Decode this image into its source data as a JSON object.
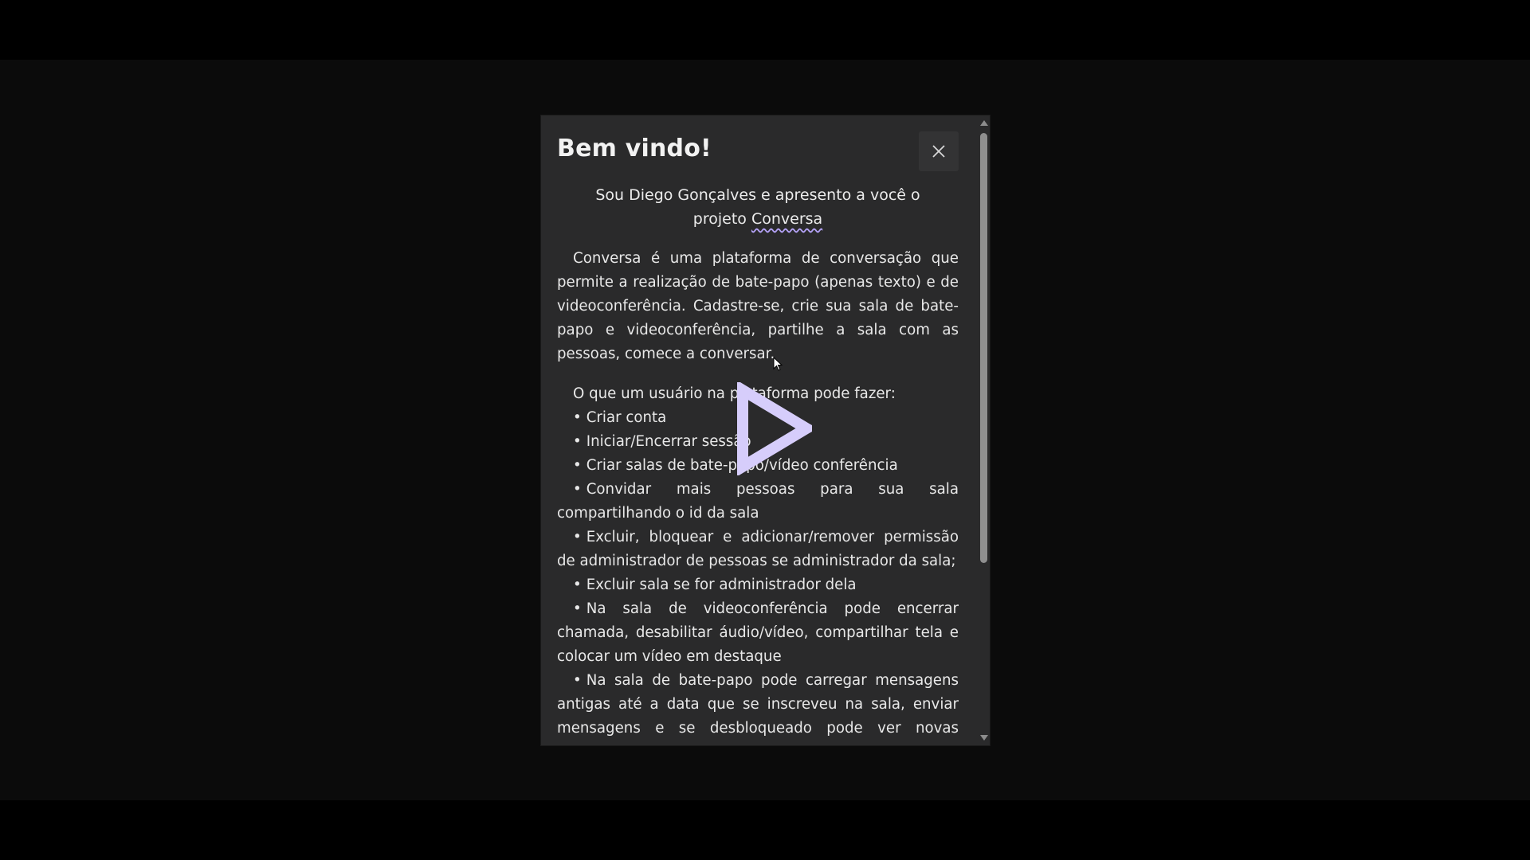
{
  "modal": {
    "title": "Bem vindo!",
    "close_icon": "close-icon",
    "intro_line1": "Sou Diego Gonçalves e apresento a você o",
    "intro_prefix": "projeto ",
    "project_name": "Conversa",
    "description": "Conversa é uma plataforma de conversação que permite a realização de bate-papo (apenas texto) e de videoconferência. Cadastre-se, crie sua sala de bate-papo e videoconferência, partilhe a sala com as pessoas, comece a conversar.",
    "features_heading": "O que um usuário na plataforma pode fazer:",
    "features": [
      "Criar conta",
      "Iniciar/Encerrar sessão",
      "Criar salas de bate-papo/vídeo conferência",
      "Convidar mais pessoas para sua sala compartilhando o id da sala",
      "Excluir, bloquear e adicionar/remover permissão de administrador de pessoas se administrador da sala;",
      "Excluir sala se for administrador dela",
      "Na sala de videoconferência pode encerrar chamada, desabilitar áudio/vídeo, compartilhar tela e colocar um vídeo em destaque",
      "Na sala de bate-papo pode carregar mensagens antigas até a data que se inscreveu na sala, enviar mensagens e se desbloqueado pode ver novas mensagens"
    ],
    "bullet": "•"
  },
  "overlay": {
    "play_icon": "play-icon",
    "play_color": "#d6cdfb",
    "cursor_icon": "cursor-icon"
  },
  "colors": {
    "background": "#000000",
    "modal_background": "#2a2a2b",
    "text": "#e8e8e8",
    "accent_underline": "#b3a1f5"
  }
}
